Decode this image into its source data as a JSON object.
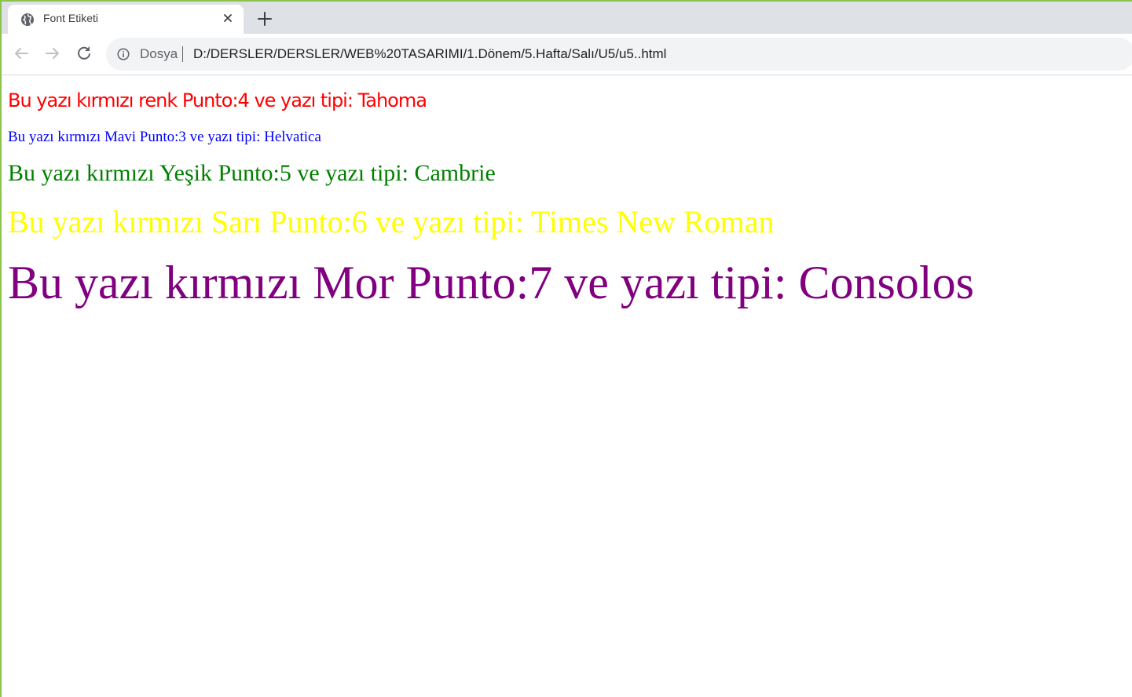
{
  "browser": {
    "tab": {
      "title": "Font Etiketi",
      "favicon_icon": "globe-icon",
      "close_icon": "close-icon"
    },
    "new_tab_icon": "plus-icon",
    "toolbar": {
      "back_icon": "arrow-left-icon",
      "forward_icon": "arrow-right-icon",
      "reload_icon": "reload-icon",
      "site_info_icon": "info-icon",
      "scheme_label": "Dosya",
      "url": "D:/DERSLER/DERSLER/WEB%20TASARIMI/1.Dönem/5.Hafta/Salı/U5/u5..html"
    }
  },
  "page": {
    "lines": [
      {
        "text": "Bu yazı kırmızı renk Punto:4 ve yazı tipi: Tahoma",
        "color": "#ff0000"
      },
      {
        "text": "Bu yazı kırmızı Mavi Punto:3 ve yazı tipi: Helvatica",
        "color": "#0000ff"
      },
      {
        "text": "Bu yazı kırmızı Yeşik Punto:5 ve yazı tipi: Cambrie",
        "color": "#008000"
      },
      {
        "text": "Bu yazı kırmızı Sarı Punto:6 ve yazı tipi: Times New Roman",
        "color": "#ffff00"
      },
      {
        "text": "Bu yazı kırmızı Mor Punto:7 ve yazı tipi: Consolos",
        "color": "#800080"
      }
    ]
  },
  "colors": {
    "window_frame": "#8cc34a",
    "tabstrip_bg": "#dee1e6",
    "omnibox_bg": "#f1f3f4"
  }
}
